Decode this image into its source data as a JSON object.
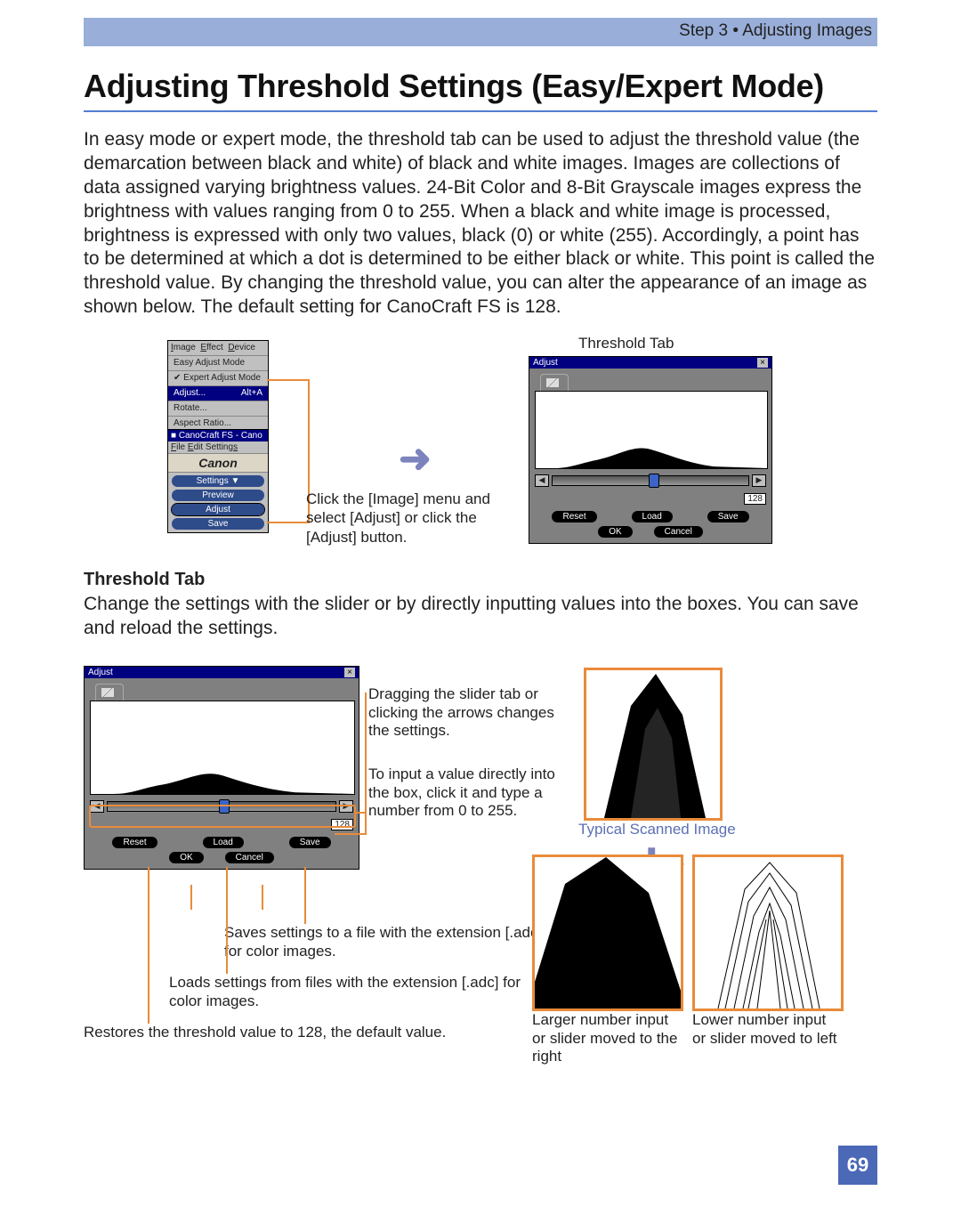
{
  "header": {
    "crumb": "Step 3 • Adjusting Images"
  },
  "title": "Adjusting Threshold Settings (Easy/Expert Mode)",
  "intro": "In easy mode or expert mode, the threshold tab can be used to adjust the threshold value (the demarcation between black and white) of black and white images. Images are collections of data assigned varying brightness values. 24-Bit Color and 8-Bit Grayscale images express the brightness with values ranging from 0 to 255. When a black and white image is processed, brightness is expressed with only two values, black (0) or white (255). Accordingly, a point has to be determined at which a dot is determined to be either black or white. This point is called the threshold value. By changing the threshold value, you can alter the appearance of an image as shown below. The default setting for CanoCraft FS is 128.",
  "menu": {
    "header_items": [
      "Image",
      "Effect",
      "Device"
    ],
    "items": [
      "Easy Adjust Mode",
      "Expert Adjust Mode",
      "Adjust...",
      "Rotate...",
      "Aspect Ratio..."
    ],
    "shortcut": "Alt+A",
    "checked_index": 1,
    "selected_index": 2
  },
  "toolbar": {
    "titlebar": "CanoCraft FS - Cano",
    "menus": [
      "File",
      "Edit",
      "Settings"
    ],
    "logo": "Canon",
    "buttons": [
      "Settings ▼",
      "Preview",
      "Adjust",
      "Save"
    ],
    "highlight_index": 2
  },
  "caption1": "Click the [Image] menu and select [Adjust] or click the [Adjust] button.",
  "tab_label_top": "Threshold Tab",
  "tabwin": {
    "title": "Adjust",
    "value": "128",
    "buttons_row1": [
      "Reset",
      "Load",
      "Save"
    ],
    "buttons_row2": [
      "OK",
      "Cancel"
    ]
  },
  "sec2": {
    "heading": "Threshold Tab",
    "body": "Change the settings with the slider or by directly inputting values into the boxes. You can save and reload the settings."
  },
  "callouts": {
    "slider": "Dragging the slider tab or clicking the arrows changes the settings.",
    "input": "To input a value directly into the box, click it and type a number from 0 to 255.",
    "save": "Saves settings to a file with the extension [.adc] for color images.",
    "load": "Loads settings from files with the extension [.adc] for color images.",
    "reset": "Restores the threshold value to 128, the default value."
  },
  "examples": {
    "typical": "Typical Scanned Image",
    "larger": "Larger number input or slider moved to the right",
    "lower": "Lower number input or slider moved to left"
  },
  "page_number": "69"
}
